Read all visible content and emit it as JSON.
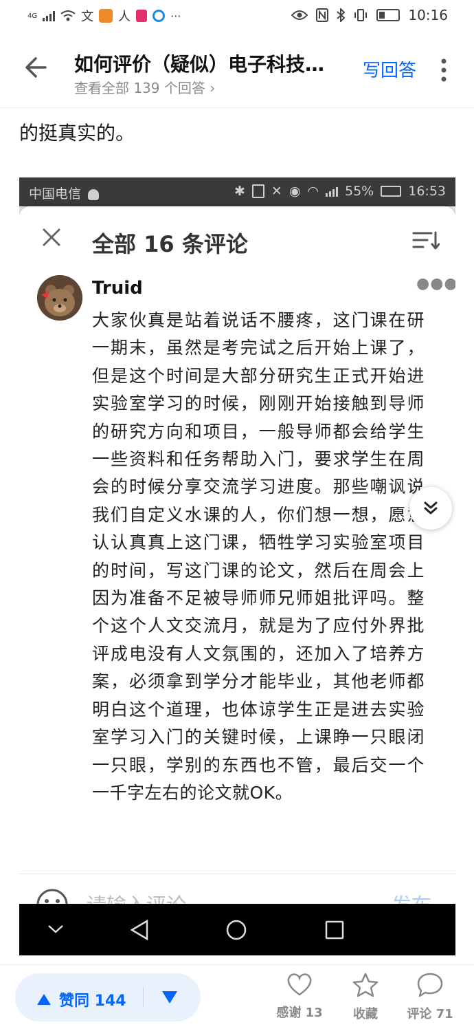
{
  "status_bar": {
    "network_label": "4G",
    "time": "10:16"
  },
  "header": {
    "title": "如何评价（疑似）电子科技…",
    "subtitle": "查看全部 139 个回答 ›",
    "write_answer": "写回答"
  },
  "answer_text": "的挺真实的。",
  "inner_screenshot": {
    "status_bar": {
      "carrier": "中国电信",
      "battery": "55%",
      "time": "16:53"
    },
    "title": "全部 16 条评论",
    "comment": {
      "author": "Truid",
      "text": "大家伙真是站着说话不腰疼，这门课在研一期末，虽然是考完试之后开始上课了，但是这个时间是大部分研究生正式开始进实验室学习的时候，刚刚开始接触到导师的研究方向和项目，一般导师都会给学生一些资料和任务帮助入门，要求学生在周会的时候分享交流学习进度。那些嘲讽说我们自定义水课的人，你们想一想，愿意认认真真上这门课，牺牲学习实验室项目的时间，写这门课的论文，然后在周会上因为准备不足被导师师兄师姐批评吗。整个这个人文交流月，就是为了应付外界批评成电没有人文氛围的，还加入了培养方案，必须拿到学分才能毕业，其他老师都明白这个道理，也体谅学生正是进去实验室学习入门的关键时候，上课睁一只眼闭一只眼，学别的东西也不管，最后交一个一千字左右的论文就OK。"
    },
    "input_placeholder": "请输入评论",
    "publish": "发布"
  },
  "bottom_bar": {
    "upvote_label": "赞同 144",
    "thanks_label": "感谢 13",
    "collect_label": "收藏",
    "comment_label": "评论 71"
  },
  "colors": {
    "accent": "#0066ff",
    "vote_bg": "#e8f1fc",
    "muted": "#8a8a8a"
  }
}
